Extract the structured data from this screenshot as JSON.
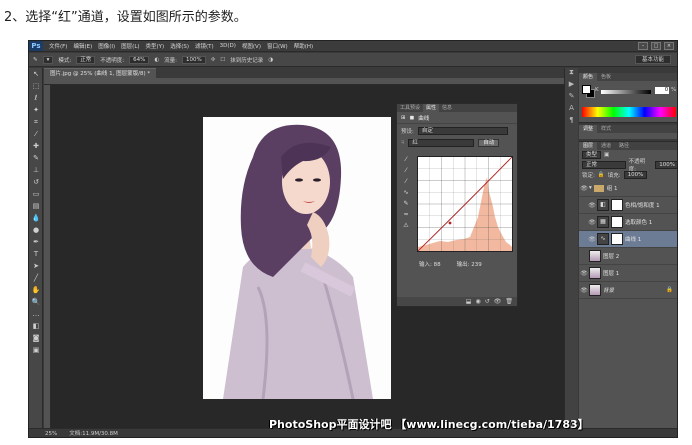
{
  "instruction": "2、选择“红”通道，设置如图所示的参数。",
  "menubar": {
    "logo": "Ps",
    "items": [
      "文件(F)",
      "编辑(E)",
      "图像(I)",
      "图层(L)",
      "类型(Y)",
      "选择(S)",
      "滤镜(T)",
      "3D(D)",
      "视图(V)",
      "窗口(W)",
      "帮助(H)"
    ]
  },
  "optionsbar": {
    "mode_label": "模式:",
    "mode_value": "正常",
    "opacity_label": "不透明度:",
    "opacity_value": "64%",
    "flow_label": "流量:",
    "flow_value": "100%",
    "history_label": "抹到历史记录",
    "workspace": "基本功能"
  },
  "document": {
    "tab_title": "图片.jpg @ 25% (曲线 1, 图层蒙版/8) *",
    "zoom": "25%",
    "doc_info": "文档:11.9M/30.8M"
  },
  "properties": {
    "tabs": [
      "工具预设",
      "属性",
      "信息"
    ],
    "active_tab": "属性",
    "title": "曲线",
    "preset_label": "预设:",
    "preset_value": "自定",
    "channel_value": "红",
    "auto_button": "自动",
    "input_label": "输入:",
    "input_value": "88",
    "output_label": "输出:",
    "output_value": "239"
  },
  "color_panel": {
    "tabs": [
      "颜色",
      "色板"
    ],
    "k_label": "K",
    "k_value": "0",
    "k_unit": "%"
  },
  "adjust_panel": {
    "tabs": [
      "调整",
      "样式"
    ]
  },
  "layers_panel": {
    "tabs": [
      "图层",
      "通道",
      "路径"
    ],
    "filter_label": "类型",
    "blend_mode": "正常",
    "opacity_label": "不透明度:",
    "opacity_value": "100%",
    "lock_label": "锁定:",
    "fill_label": "填充:",
    "fill_value": "100%",
    "layers": [
      {
        "name": "组 1",
        "kind": "group",
        "selected": false
      },
      {
        "name": "色相/饱和度 1",
        "kind": "adjustment",
        "selected": false
      },
      {
        "name": "选取颜色 1",
        "kind": "adjustment",
        "selected": false
      },
      {
        "name": "曲线 1",
        "kind": "adjustment",
        "selected": true
      },
      {
        "name": "图层 2",
        "kind": "pixel",
        "selected": false
      },
      {
        "name": "图层 1",
        "kind": "pixel",
        "selected": false
      },
      {
        "name": "背景",
        "kind": "pixel",
        "selected": false
      }
    ]
  },
  "watermark": "PhotoShop平面设计吧 【www.linecg.com/tieba/1783】",
  "colors": {
    "ui_dark": "#3a3a3a",
    "panel": "#535353",
    "selected_layer": "#6c7c94",
    "curve_line": "#b22222",
    "histogram": "#f2b9a0"
  }
}
